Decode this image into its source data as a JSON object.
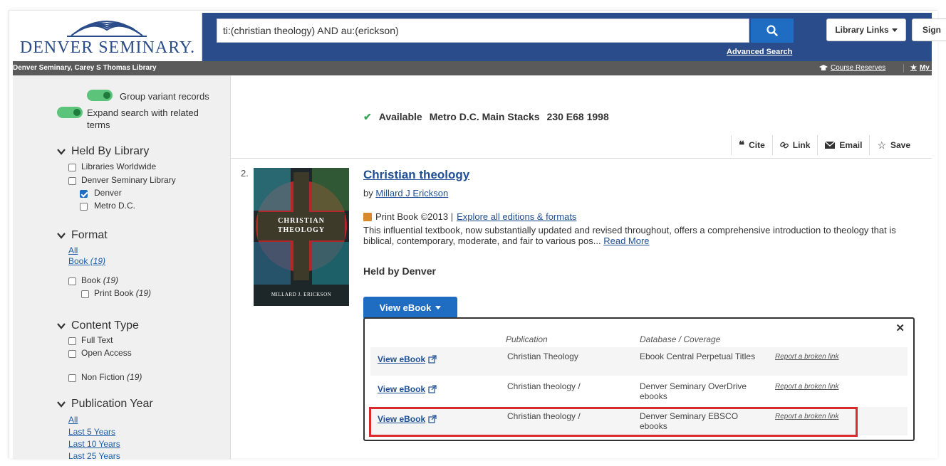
{
  "header": {
    "logo_text": "DENVER SEMINARY.",
    "search_query": "ti:(christian theology) AND au:(erickson)",
    "advanced_search": "Advanced Search",
    "library_links": "Library Links",
    "sign_in": "Sign"
  },
  "subbar": {
    "title": "Denver Seminary, Carey S Thomas Library",
    "course_reserves": "Course Reserves",
    "my_link": "My I"
  },
  "sidebar": {
    "group_variant": "Group variant records",
    "expand_search": "Expand search with related terms",
    "held_by": {
      "heading": "Held By Library",
      "items": [
        "Libraries Worldwide",
        "Denver Seminary Library",
        "Denver",
        "Metro D.C."
      ]
    },
    "format": {
      "heading": "Format",
      "all": "All",
      "book_link": "Book",
      "book_link_count": "(19)",
      "book": "Book",
      "book_count": "(19)",
      "print_book": "Print Book",
      "print_book_count": "(19)"
    },
    "content_type": {
      "heading": "Content Type",
      "items": [
        "Full Text",
        "Open Access"
      ],
      "non_fiction": "Non Fiction",
      "non_fiction_count": "(19)"
    },
    "pub_year": {
      "heading": "Publication Year",
      "items": [
        "All",
        "Last 5 Years",
        "Last 10 Years",
        "Last 25 Years"
      ]
    }
  },
  "previous_record": {
    "status": "Available",
    "location": "Metro D.C. Main Stacks",
    "call_number": "230 E68 1998"
  },
  "actions": {
    "cite": "Cite",
    "link": "Link",
    "email": "Email",
    "save": "Save"
  },
  "record": {
    "number": "2.",
    "cover_title": "CHRISTIAN THEOLOGY",
    "cover_author": "MILLARD J. ERICKSON",
    "title": "Christian theology",
    "by_prefix": "by",
    "author": "Millard J Erickson",
    "format_text": "Print Book ©2013 |",
    "editions_link": "Explore all editions & formats",
    "description": "This influential textbook, now substantially updated and revised throughout, offers a comprehensive introduction to theology that is biblical, contemporary, moderate, and fair to various pos...",
    "read_more": "Read More",
    "held_by": "Held by Denver",
    "view_ebook_button": "View eBook"
  },
  "ebook_popup": {
    "col_publication": "Publication",
    "col_database": "Database / Coverage",
    "rows": [
      {
        "link": "View eBook",
        "publication": "Christian Theology",
        "database": "Ebook Central Perpetual Titles",
        "report": "Report a broken link"
      },
      {
        "link": "View eBook",
        "publication": "Christian theology /",
        "database": "Denver Seminary OverDrive ebooks",
        "report": "Report a broken link"
      },
      {
        "link": "View eBook",
        "publication": "Christian theology /",
        "database": "Denver Seminary EBSCO ebooks",
        "report": "Report a broken link"
      }
    ]
  },
  "colors": {
    "header_blue": "#2b4c8a",
    "button_blue": "#1f6dc2",
    "link_blue": "#1f4f94",
    "highlight_red": "#d92b2b",
    "toggle_green": "#5cc47a"
  }
}
